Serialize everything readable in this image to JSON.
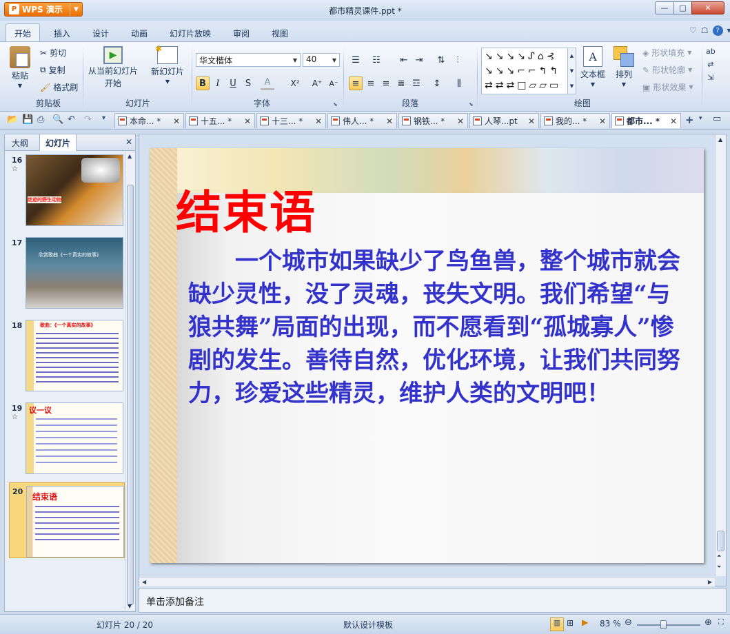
{
  "app": {
    "name": "WPS 演示",
    "logo_letter": "P",
    "window_title": "都市精灵课件.ppt *"
  },
  "window_controls": {
    "minimize": "—",
    "maximize": "□",
    "close": "✕"
  },
  "ribbon_tabs": [
    {
      "label": "开始",
      "active": true
    },
    {
      "label": "插入"
    },
    {
      "label": "设计"
    },
    {
      "label": "动画"
    },
    {
      "label": "幻灯片放映"
    },
    {
      "label": "审阅"
    },
    {
      "label": "视图"
    }
  ],
  "ribbon": {
    "clipboard": {
      "paste": "粘贴",
      "cut": "剪切",
      "copy": "复制",
      "format_painter": "格式刷",
      "group": "剪贴板"
    },
    "slides": {
      "from_current": "从当前幻灯片",
      "start": "开始",
      "new_slide": "新幻灯片",
      "group": "幻灯片"
    },
    "font": {
      "name": "华文楷体",
      "size": "40",
      "bold": "B",
      "italic": "I",
      "underline": "U",
      "strike": "S",
      "font_color": "A",
      "change_case": "X²",
      "grow": "A⁺",
      "shrink": "A⁻",
      "group": "字体"
    },
    "paragraph": {
      "group": "段落"
    },
    "drawing": {
      "textbox": "文本框",
      "arrange": "排列",
      "fill": "形状填充",
      "outline": "形状轮廓",
      "effect": "形状效果",
      "group": "绘图"
    }
  },
  "doc_tabs": [
    {
      "label": "本命... *"
    },
    {
      "label": "十五... *"
    },
    {
      "label": "十三... *"
    },
    {
      "label": "伟人... *"
    },
    {
      "label": "钢铁... *"
    },
    {
      "label": "人琴...pt"
    },
    {
      "label": "我的... *"
    },
    {
      "label": "都市... *",
      "active": true
    }
  ],
  "left_panel": {
    "tabs": [
      {
        "label": "大纲"
      },
      {
        "label": "幻灯片",
        "active": true
      }
    ],
    "thumbnails": [
      {
        "num": "16",
        "star": "☆",
        "caption": "绝迹的野生动物"
      },
      {
        "num": "17",
        "star": "",
        "caption": "欣赏歌曲《一个真实的故事》"
      },
      {
        "num": "18",
        "star": "",
        "caption": "歌曲：《一个真实的故事》"
      },
      {
        "num": "19",
        "star": "☆",
        "caption": "议一议"
      },
      {
        "num": "20",
        "star": "",
        "caption": "结束语",
        "selected": true
      }
    ]
  },
  "slide": {
    "title": "结束语",
    "body": "一个城市如果缺少了鸟鱼兽，整个城市就会缺少灵性，没了灵魂，丧失文明。我们希望“与狼共舞”局面的出现，而不愿看到“孤城寡人”惨剧的发生。善待自然，优化环境，让我们共同努力，珍爱这些精灵，维护人类的文明吧！"
  },
  "notes": {
    "placeholder": "单击添加备注"
  },
  "status": {
    "slide_counter": "幻灯片 20 / 20",
    "template": "默认设计模板",
    "zoom": "83 %",
    "zoom_level": 0.83
  },
  "colors": {
    "title_red": "#ff0000",
    "body_blue": "#3333cc",
    "selection": "#f8d77c"
  }
}
